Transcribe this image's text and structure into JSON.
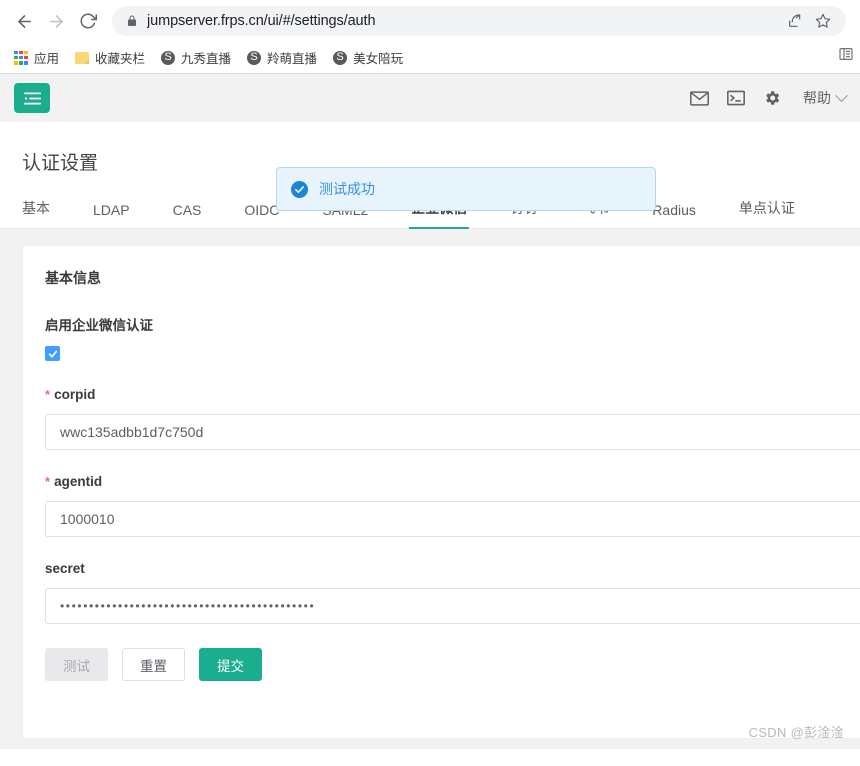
{
  "browser": {
    "back_label": "back",
    "forward_label": "forward",
    "reload_label": "reload",
    "url": "jumpserver.frps.cn/ui/#/settings/auth",
    "lock_icon": "lock-icon",
    "share_icon": "share-icon",
    "bookmark_star_icon": "star-icon",
    "reading_list_icon": "reading-list-icon",
    "bookmarks": [
      {
        "label": "应用",
        "icon": "apps-grid-icon"
      },
      {
        "label": "收藏夹栏",
        "icon": "folder-icon"
      },
      {
        "label": "九秀直播",
        "icon": "globe-icon"
      },
      {
        "label": "羚萌直播",
        "icon": "globe-icon"
      },
      {
        "label": "美女陪玩",
        "icon": "globe-icon"
      }
    ]
  },
  "header": {
    "menu_toggle_icon": "list-menu-icon",
    "mail_icon": "envelope-icon",
    "terminal_icon": "terminal-icon",
    "settings_icon": "gear-icon",
    "help_label": "帮助",
    "chevron_icon": "chevron-down-icon"
  },
  "toast": {
    "message": "测试成功",
    "icon": "check-circle-icon",
    "background": "#e8f4fb",
    "border": "#b3d8ef",
    "text_color": "#3a8ee6"
  },
  "page": {
    "title": "认证设置"
  },
  "tabs": [
    {
      "label": "基本",
      "active": false
    },
    {
      "label": "LDAP",
      "active": false
    },
    {
      "label": "CAS",
      "active": false
    },
    {
      "label": "OIDC",
      "active": false
    },
    {
      "label": "SAML2",
      "active": false
    },
    {
      "label": "企业微信",
      "active": true
    },
    {
      "label": "钉钉",
      "active": false
    },
    {
      "label": "飞书",
      "active": false
    },
    {
      "label": "Radius",
      "active": false
    },
    {
      "label": "单点认证",
      "active": false
    }
  ],
  "form": {
    "card_title": "基本信息",
    "enable_label": "启用企业微信认证",
    "enable_checked": true,
    "fields": [
      {
        "label": "corpid",
        "required": true,
        "value": "wwc135adbb1d7c750d",
        "placeholder": "corpid",
        "masked": false
      },
      {
        "label": "agentid",
        "required": true,
        "value": "1000010",
        "placeholder": "agentid",
        "masked": false
      },
      {
        "label": "secret",
        "required": false,
        "value": "••••••••••••••••••••••••••••••••••••••••••••",
        "placeholder": "secret",
        "masked": true
      }
    ],
    "buttons": [
      {
        "label": "测试",
        "style": "disabled"
      },
      {
        "label": "重置",
        "style": "default"
      },
      {
        "label": "提交",
        "style": "primary"
      }
    ]
  },
  "watermark": "CSDN @彭淦淦",
  "colors": {
    "brand_green": "#1aae8e",
    "checkbox_blue": "#409eff",
    "required_red": "#f56c6c"
  }
}
